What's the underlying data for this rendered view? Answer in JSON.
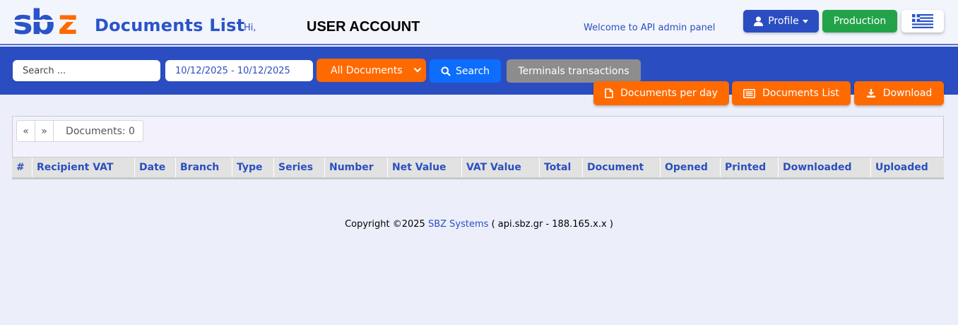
{
  "header": {
    "logo_text": "sbz",
    "title": "Documents List",
    "greeting": "Hi,",
    "user": "USER ACCOUNT",
    "welcome": "Welcome to API admin panel",
    "profile_label": "Profile",
    "production_label": "Production",
    "language": "Greek flag"
  },
  "toolbar": {
    "search_placeholder": "Search ...",
    "date_range": "10/12/2025 - 10/12/2025",
    "document_filter": "All Documents",
    "search_label": "Search",
    "terminals_label": "Terminals transactions",
    "per_day_label": "Documents per day",
    "doc_list_label": "Documents List",
    "download_label": "Download"
  },
  "colors": {
    "brand_blue": "#2a4ec2",
    "accent_orange": "#ff6a00",
    "success_green": "#22a34a",
    "primary_blue": "#0d6efd",
    "muted_gray": "#8d8d8d"
  },
  "pager": {
    "prev": "«",
    "next": "»",
    "count": "Documents: 0"
  },
  "table": {
    "columns": [
      "#",
      "Recipient VAT",
      "Date",
      "Branch",
      "Type",
      "Series",
      "Number",
      "Net Value",
      "VAT Value",
      "Total",
      "Document",
      "Opened",
      "Printed",
      "Downloaded",
      "Uploaded"
    ],
    "rows": []
  },
  "footer": {
    "copyright": "Copyright ©2025",
    "company": "SBZ Systems",
    "host": "( api.sbz.gr - 188.165.x.x )"
  }
}
